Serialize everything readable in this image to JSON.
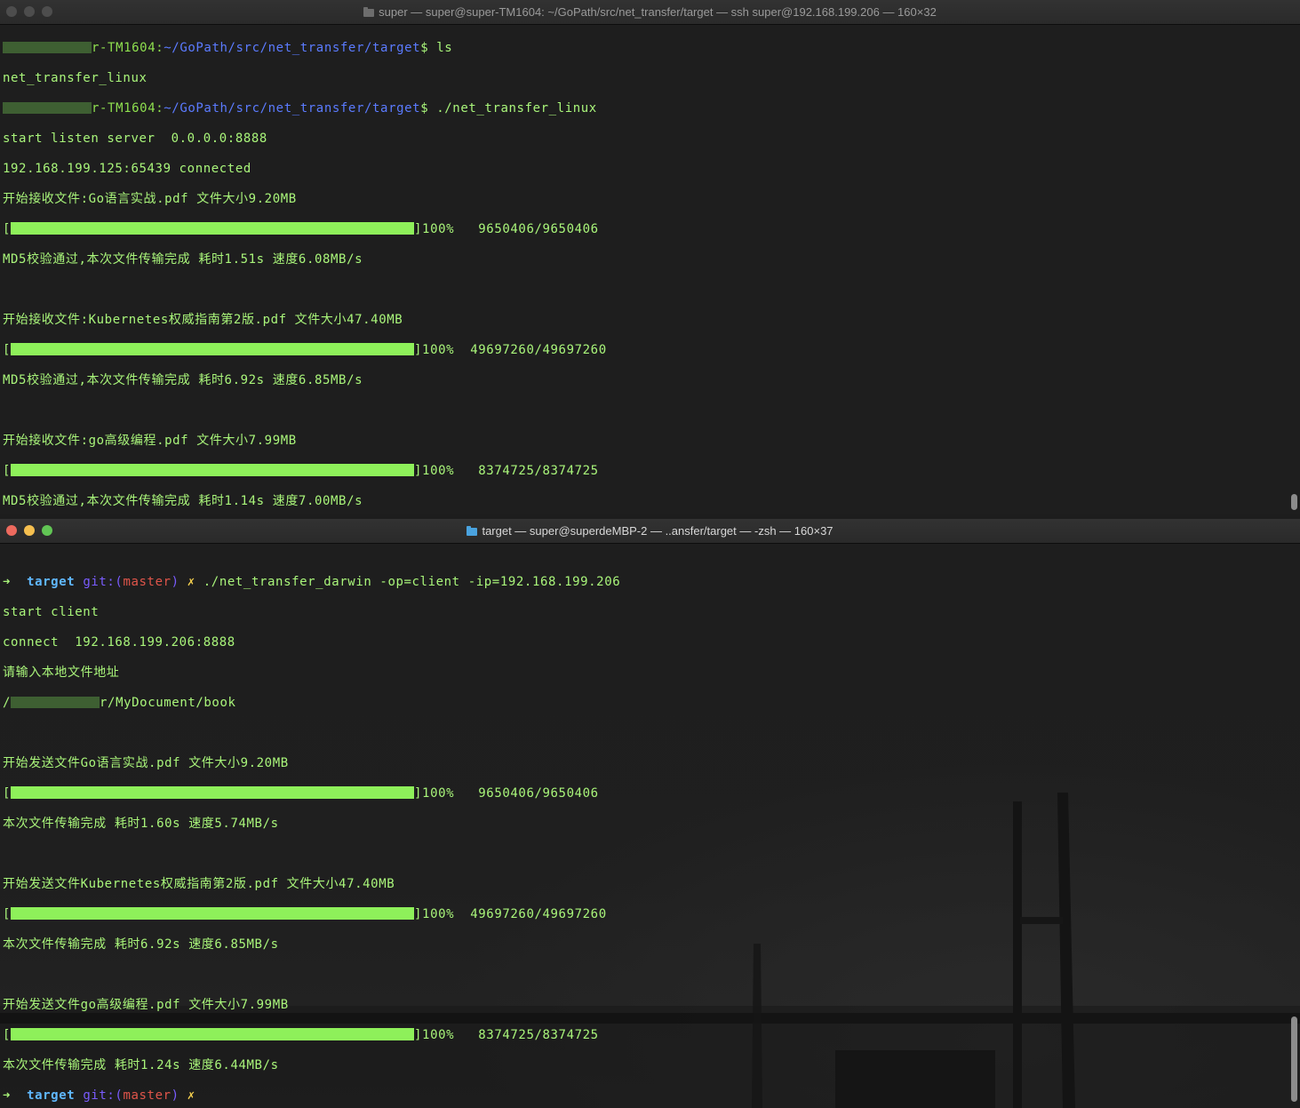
{
  "top_window": {
    "title": "super — super@super-TM1604: ~/GoPath/src/net_transfer/target — ssh super@192.168.199.206 — 160×32",
    "prompt_host_suffix": "r-TM1604:",
    "prompt_path": "~/GoPath/src/net_transfer/target",
    "prompt_symbol": "$",
    "cmd1": " ls",
    "ls_output": "net_transfer_linux",
    "cmd2": " ./net_transfer_linux",
    "lines": {
      "listen": "start listen server  0.0.0.0:8888",
      "connected": "192.168.199.125:65439 connected",
      "recv1": "开始接收文件:Go语言实战.pdf 文件大小9.20MB",
      "prog1_pct": "]100%",
      "prog1_count": "   9650406/9650406",
      "done1": "MD5校验通过,本次文件传输完成 耗时1.51s 速度6.08MB/s",
      "recv2": "开始接收文件:Kubernetes权威指南第2版.pdf 文件大小47.40MB",
      "prog2_pct": "]100%",
      "prog2_count": "  49697260/49697260",
      "done2": "MD5校验通过,本次文件传输完成 耗时6.92s 速度6.85MB/s",
      "recv3": "开始接收文件:go高级编程.pdf 文件大小7.99MB",
      "prog3_pct": "]100%",
      "prog3_count": "   8374725/8374725",
      "done3": "MD5校验通过,本次文件传输完成 耗时1.14s 速度7.00MB/s"
    }
  },
  "bottom_window": {
    "title": "target — super@superdeMBP-2 — ..ansfer/target — -zsh — 160×37",
    "prompt_arrow": "➜",
    "prompt_dir": "target",
    "git_label": "git:(",
    "branch": "master",
    "git_close": ")",
    "dirty_mark": "✗",
    "command": " ./net_transfer_darwin -op=client -ip=192.168.199.206",
    "lines": {
      "start": "start client",
      "connect": "connect  192.168.199.206:8888",
      "ask": "请输入本地文件地址",
      "path_tail": "r/MyDocument/book",
      "send1": "开始发送文件Go语言实战.pdf 文件大小9.20MB",
      "prog1_pct": "]100%",
      "prog1_count": "   9650406/9650406",
      "done1": "本次文件传输完成 耗时1.60s 速度5.74MB/s",
      "send2": "开始发送文件Kubernetes权威指南第2版.pdf 文件大小47.40MB",
      "prog2_pct": "]100%",
      "prog2_count": "  49697260/49697260",
      "done2": "本次文件传输完成 耗时6.92s 速度6.85MB/s",
      "send3": "开始发送文件go高级编程.pdf 文件大小7.99MB",
      "prog3_pct": "]100%",
      "prog3_count": "   8374725/8374725",
      "done3": "本次文件传输完成 耗时1.24s 速度6.44MB/s"
    }
  },
  "progress_fraction": 1.0,
  "icons": [
    "folder-icon",
    "close-light",
    "minimize-light",
    "zoom-light",
    "cursor-block"
  ]
}
